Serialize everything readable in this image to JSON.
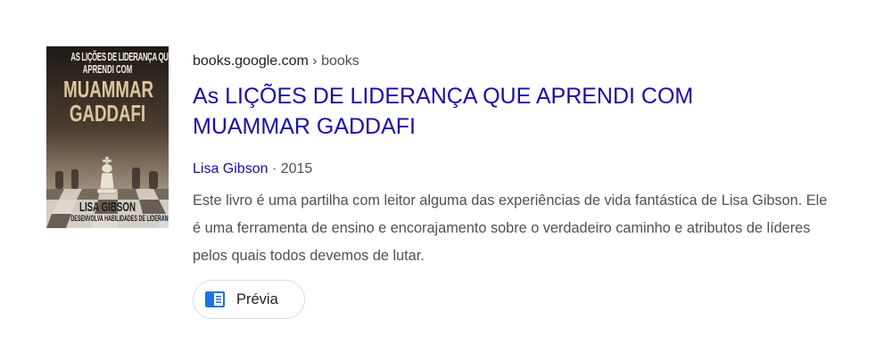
{
  "result": {
    "source_site": "books.google.com",
    "source_separator": " › ",
    "source_path": "books",
    "title": "As LIÇÕES DE LIDERANÇA QUE APRENDI COM MUAMMAR GADDAFI",
    "author": "Lisa Gibson",
    "meta_separator": " · ",
    "year": "2015",
    "snippet": "Este livro é uma partilha com leitor alguma das experiências de vida fantástica de Lisa Gibson. Ele é uma ferramenta de ensino e encorajamento sobre o verdadeiro caminho e atributos de líderes pelos quais todos devemos de lutar.",
    "preview_label": "Prévia",
    "preview_icon": "book-preview-icon"
  },
  "cover": {
    "line1": "AS LIÇÕES DE LIDERANÇA QUE",
    "line2": "APRENDI COM",
    "line3": "MUAMMAR",
    "line4": "GADDAFI",
    "author": "LISA GIBSON",
    "subtitle": "DESENVOLVA HABILIDADES DE LIDERANÇA",
    "accent_color": "#dcc6a0"
  },
  "colors": {
    "link": "#1a0dab",
    "text": "#4d5156",
    "icon": "#1a73e8"
  }
}
